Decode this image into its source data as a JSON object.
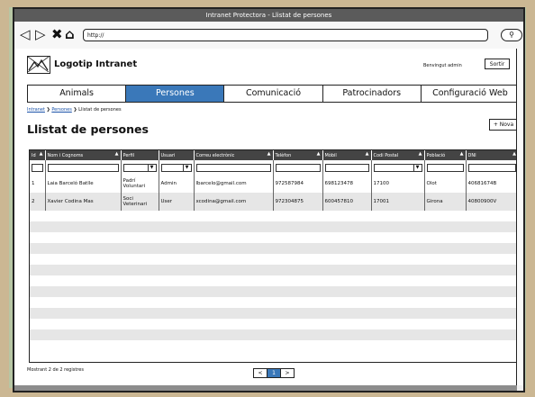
{
  "window": {
    "title": "Intranet Protectora - Llistat de persones"
  },
  "addressbar": {
    "url": "http://"
  },
  "header": {
    "logo_text": "Logotip Intranet",
    "welcome": "Benvingut admin",
    "logout_label": "Sortir"
  },
  "menu": [
    {
      "label": "Animals"
    },
    {
      "label": "Persones"
    },
    {
      "label": "Comunicació"
    },
    {
      "label": "Patrocinadors"
    },
    {
      "label": "Configuració Web"
    }
  ],
  "breadcrumb": {
    "root": "Intranet",
    "section": "Persones",
    "current": "Llistat de persones"
  },
  "page": {
    "title": "Llistat de persones",
    "new_button": "+ Nova"
  },
  "table": {
    "columns": [
      "Id",
      "Nom i Cognoms",
      "Perfil",
      "Usuari",
      "Correu electrònic",
      "Telèfon",
      "Mòbil",
      "Codi Postal",
      "Població",
      "DNI"
    ],
    "rows": [
      [
        "1",
        "Laia Barceló Batlle",
        "Padrí Voluntari",
        "Admin",
        "lbarcelo@gmail.com",
        "972587984",
        "698123478",
        "17100",
        "Olot",
        "40681674B"
      ],
      [
        "2",
        "Xavier Codina Mas",
        "Soci Veterinari",
        "User",
        "xcodina@gmail.com",
        "972304875",
        "600457810",
        "17001",
        "Girona",
        "40800900V"
      ]
    ]
  },
  "footer": {
    "count_text": "Mostrant 2 de 2 registres"
  },
  "pager": {
    "prev": "<",
    "current": "1",
    "next": ">"
  }
}
